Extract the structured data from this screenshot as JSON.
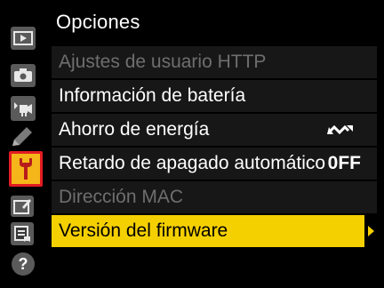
{
  "header": {
    "title": "Opciones"
  },
  "sidebar": {
    "tabs": [
      {
        "name": "playback-menu-icon"
      },
      {
        "name": "photo-shooting-menu-icon"
      },
      {
        "name": "movie-shooting-menu-icon"
      },
      {
        "name": "custom-settings-pencil-icon"
      },
      {
        "name": "setup-menu-wrench-icon",
        "active": true
      },
      {
        "name": "retouch-menu-icon"
      },
      {
        "name": "my-menu-icon"
      },
      {
        "name": "help-icon",
        "label": "?"
      }
    ]
  },
  "menu": {
    "items": [
      {
        "label": "Ajustes de usuario HTTP",
        "state": "disabled"
      },
      {
        "label": "Información de batería",
        "state": "normal"
      },
      {
        "label": "Ahorro de energía",
        "state": "normal",
        "value_icon": "wave-arrow-icon"
      },
      {
        "label": "Retardo de apagado automático",
        "state": "normal",
        "value": "0FF"
      },
      {
        "label": "Dirección MAC",
        "state": "disabled"
      },
      {
        "label": "Versión del firmware",
        "state": "selected",
        "trailing_icon": "right-arrow-icon"
      }
    ]
  },
  "colors": {
    "highlight": "#f5d000",
    "active_tab": "#f4b619",
    "active_tab_border": "#e21b23",
    "row_bg": "#171717",
    "disabled_text": "#6e6e6e"
  }
}
